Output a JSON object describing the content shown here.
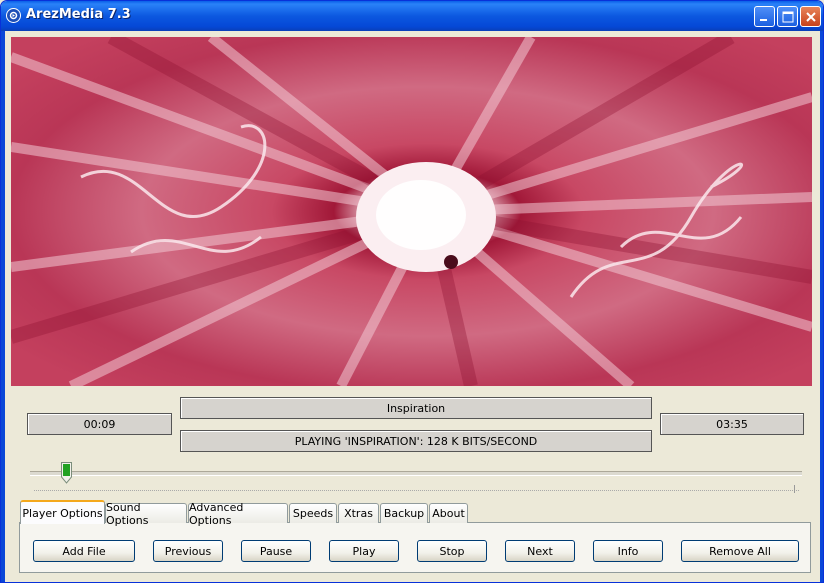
{
  "window": {
    "title": "ArezMedia 7.3",
    "icons": {
      "app": "app-logo-icon",
      "minimize": "minimize-icon",
      "maximize": "maximize-icon",
      "close": "close-icon"
    }
  },
  "visualization": {
    "description_colors": {
      "base": "#c4405e",
      "light": "#f7dde3",
      "dark": "#8a1030"
    }
  },
  "player": {
    "elapsed_time": "00:09",
    "total_time": "03:35",
    "track_title": "Inspiration",
    "status": "PLAYING  'INSPIRATION':  128  K  BITS/SECOND",
    "progress_fraction": 0.04
  },
  "tabs": [
    {
      "label": "Player Options",
      "active": true
    },
    {
      "label": "Sound Options"
    },
    {
      "label": "Advanced Options"
    },
    {
      "label": "Speeds"
    },
    {
      "label": "Xtras"
    },
    {
      "label": "Backup"
    },
    {
      "label": "About"
    }
  ],
  "buttons": {
    "add_file": "Add File",
    "previous": "Previous",
    "pause": "Pause",
    "play": "Play",
    "stop": "Stop",
    "next": "Next",
    "info": "Info",
    "remove_all": "Remove All"
  },
  "colors": {
    "titlebar": "#0a5fe8",
    "close_button": "#c8421a",
    "active_tab_accent": "#f4a81c"
  }
}
